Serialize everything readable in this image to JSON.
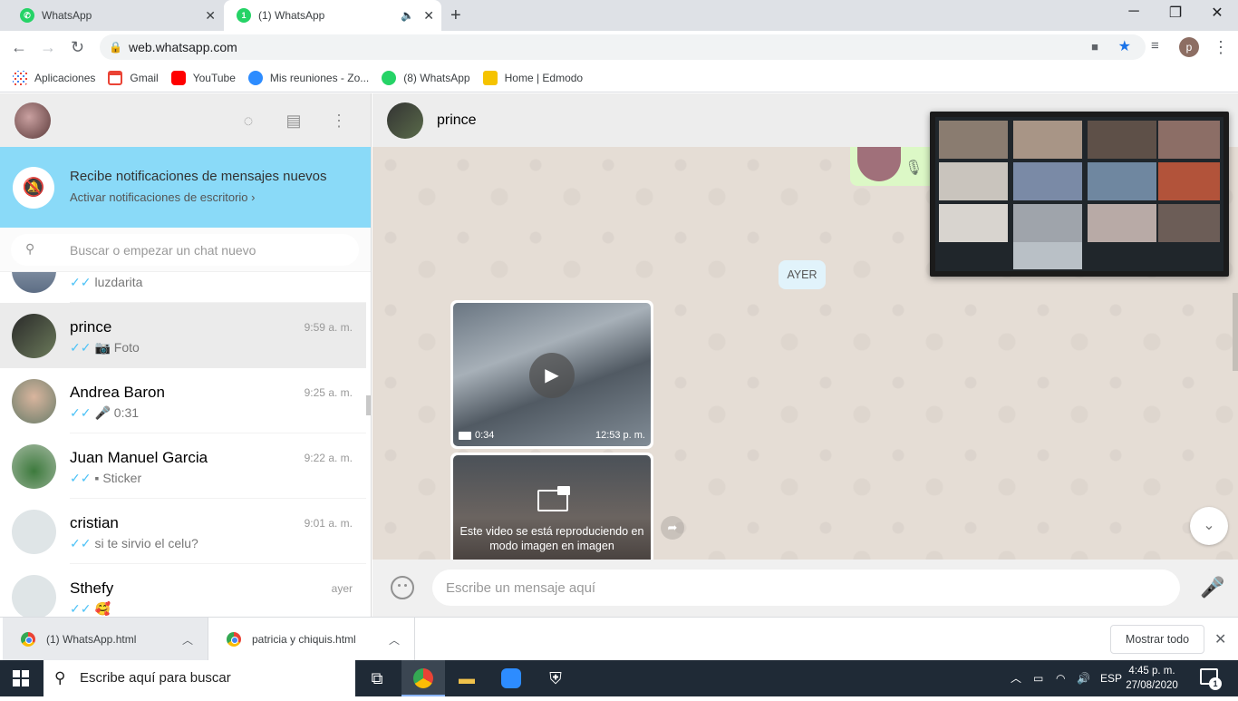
{
  "browser": {
    "tabs": [
      {
        "title": "WhatsApp",
        "badge": ""
      },
      {
        "title": "(1) WhatsApp",
        "badge": "1"
      }
    ],
    "url": "web.whatsapp.com",
    "profile_initial": "p",
    "bookmarks": [
      {
        "label": "Aplicaciones",
        "icon": "apps-grid-icon"
      },
      {
        "label": "Gmail",
        "icon": "gmail-icon"
      },
      {
        "label": "YouTube",
        "icon": "youtube-icon"
      },
      {
        "label": "Mis reuniones - Zo...",
        "icon": "zoom-icon"
      },
      {
        "label": "(8) WhatsApp",
        "icon": "whatsapp-icon"
      },
      {
        "label": "Home | Edmodo",
        "icon": "edmodo-icon"
      }
    ]
  },
  "sidebar": {
    "notification": {
      "title": "Recibe notificaciones de mensajes nuevos",
      "subtitle": "Activar notificaciones de escritorio ›"
    },
    "search_placeholder": "Buscar o empezar un chat nuevo",
    "chats": [
      {
        "name": "",
        "time": "",
        "last": "luzdarita",
        "media": ""
      },
      {
        "name": "prince",
        "time": "9:59 a. m.",
        "last": "Foto",
        "media": "📷"
      },
      {
        "name": "Andrea Baron",
        "time": "9:25 a. m.",
        "last": "0:31",
        "media": "🎤"
      },
      {
        "name": "Juan Manuel Garcia",
        "time": "9:22 a. m.",
        "last": "Sticker",
        "media": "▪"
      },
      {
        "name": "cristian",
        "time": "9:01 a. m.",
        "last": "si te sirvio el celu?",
        "media": ""
      },
      {
        "name": "Sthefy",
        "time": "ayer",
        "last": "🥰",
        "media": ""
      }
    ]
  },
  "conversation": {
    "contact_name": "prince",
    "date_chip": "AYER",
    "video1": {
      "duration": "0:34",
      "time": "12:53 p. m."
    },
    "video2": {
      "message": "Este video se está reproduciendo en modo imagen en imagen"
    },
    "composer_placeholder": "Escribe un mensaje aquí"
  },
  "downloads": {
    "items": [
      "(1) WhatsApp.html",
      "patricia y chiquis.html"
    ],
    "show_all": "Mostrar todo"
  },
  "taskbar": {
    "search_placeholder": "Escribe aquí para buscar",
    "language": "ESP",
    "time": "4:45 p. m.",
    "date": "27/08/2020",
    "notification_count": "1"
  }
}
